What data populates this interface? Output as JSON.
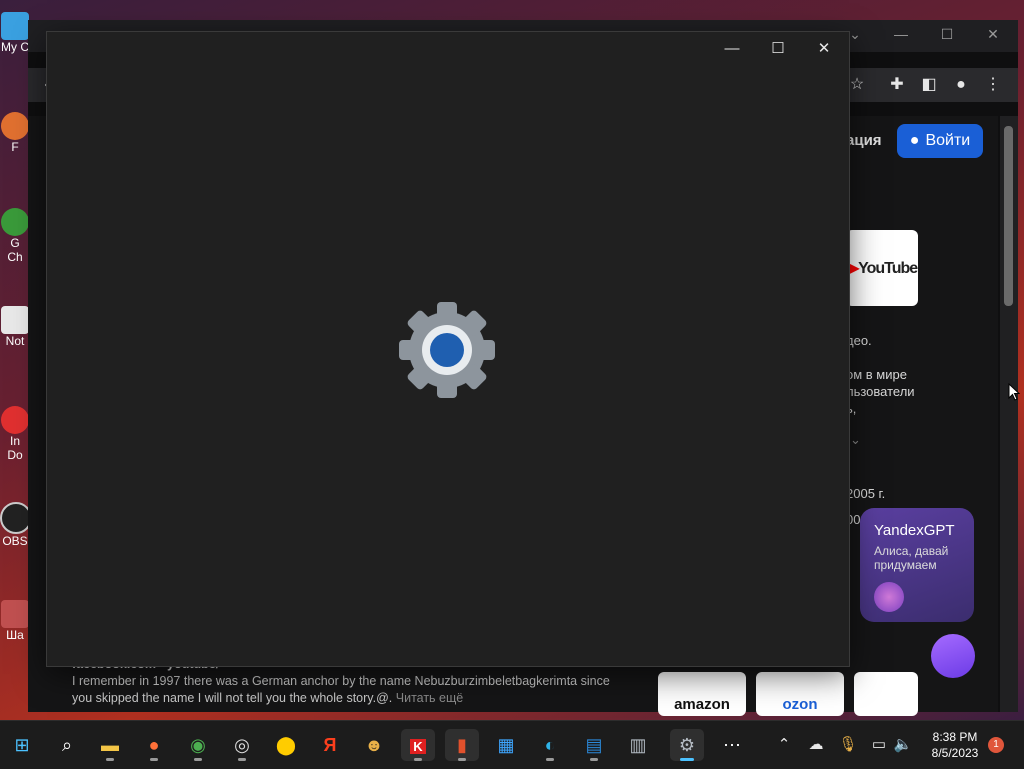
{
  "desktop": {
    "icons": [
      {
        "label": "My C",
        "color": "#3aa0e0"
      },
      {
        "label": "F",
        "color": "#e07030"
      },
      {
        "label": "G\nCh",
        "color": "#3a9a3a"
      },
      {
        "label": "Not",
        "color": "#e8e8e8"
      },
      {
        "label": "In\nDo",
        "color": "#e03030"
      },
      {
        "label": "OBS",
        "color": "#cccccc"
      },
      {
        "label": "Ша",
        "color": "#c05050"
      }
    ]
  },
  "browser": {
    "nav_partial": "ация",
    "login_label": "Войти",
    "youtube_logo_text": "YouTube",
    "page_text": {
      "line1": "део.",
      "line2": "ом в мире",
      "line3": "льзователи",
      "line4": "ь,",
      "year": "2005 г.",
      "partial_num": "00"
    },
    "yandexgpt": {
      "title": "YandexGPT",
      "subtitle": "Алиса, давай придумаем"
    },
    "shops": [
      "amazon",
      "ozon",
      ""
    ],
    "snippet": {
      "source": "facebook.com › youtube/",
      "text": "I remember in 1997 there was a German anchor by the name Nebuzburzimbeletbagkerimta since you skipped the name I will not tell you the whole story.@.",
      "read_more": "Читать ещё"
    }
  },
  "settings_window": {
    "minimize": "—",
    "maximize": "☐",
    "close": "✕",
    "icon": "settings-gear-icon"
  },
  "taskbar": {
    "apps": [
      {
        "name": "start-icon",
        "glyph": "⊞",
        "color": "#4cc2ff"
      },
      {
        "name": "search-icon",
        "glyph": "⌕",
        "color": "#ffffff"
      },
      {
        "name": "file-explorer-icon",
        "glyph": "▬",
        "color": "#f3c546"
      },
      {
        "name": "firefox-icon",
        "glyph": "●",
        "color": "#ff7139"
      },
      {
        "name": "chrome-icon",
        "glyph": "◉",
        "color": "#4caf50"
      },
      {
        "name": "obs-icon",
        "glyph": "◎",
        "color": "#dddddd"
      },
      {
        "name": "yandex-market-icon",
        "glyph": "⬤",
        "color": "#ffcc00"
      },
      {
        "name": "yandex-browser-icon",
        "glyph": "Я",
        "color": "#fc3f1d"
      },
      {
        "name": "game-icon",
        "glyph": "☻",
        "color": "#e8b048"
      },
      {
        "name": "kaspersky-icon",
        "glyph": "K",
        "color": "#e02020"
      },
      {
        "name": "office-icon",
        "glyph": "▮",
        "color": "#e2512c"
      },
      {
        "name": "store-icon",
        "glyph": "▦",
        "color": "#3ea6ff"
      },
      {
        "name": "edge-icon",
        "glyph": "◐",
        "color": "#2fb3e8"
      },
      {
        "name": "calendar-icon",
        "glyph": "▤",
        "color": "#2b88d8"
      },
      {
        "name": "calculator-icon",
        "glyph": "▥",
        "color": "#b0b8c0"
      },
      {
        "name": "settings-icon",
        "glyph": "⚙",
        "color": "#b5bcc4"
      },
      {
        "name": "more-icon",
        "glyph": "⋯",
        "color": "#ffffff"
      }
    ],
    "clock_time": "8:38 PM",
    "clock_date": "8/5/2023",
    "notification_count": "1"
  }
}
